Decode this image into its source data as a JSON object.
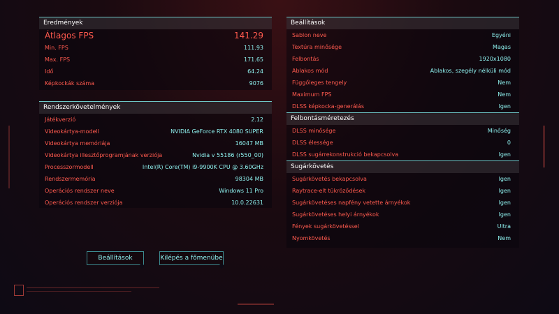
{
  "results": {
    "title": "Eredmények",
    "avg_label": "Átlagos FPS",
    "avg_value": "141.29",
    "rows": [
      {
        "label": "Min. FPS",
        "value": "111.93"
      },
      {
        "label": "Max. FPS",
        "value": "171.65"
      },
      {
        "label": "Idő",
        "value": "64.24"
      },
      {
        "label": "Képkockák száma",
        "value": "9076"
      }
    ]
  },
  "system": {
    "title": "Rendszerkövetelmények",
    "rows": [
      {
        "label": "Játékverzió",
        "value": "2.12"
      },
      {
        "label": "Videokártya-modell",
        "value": "NVIDIA GeForce RTX 4080 SUPER"
      },
      {
        "label": "Videokártya memóriája",
        "value": "16047 MB"
      },
      {
        "label": "Videokártya illesztőprogramjának verziója",
        "value": "Nvidia v 55186 (r550_00)"
      },
      {
        "label": "Processzormodell",
        "value": "Intel(R) Core(TM) i9-9900K CPU @ 3.60GHz"
      },
      {
        "label": "Rendszermemória",
        "value": "98304 MB"
      },
      {
        "label": "Operációs rendszer neve",
        "value": "Windows 11 Pro"
      },
      {
        "label": "Operációs rendszer verziója",
        "value": "10.0.22631"
      }
    ]
  },
  "settings": {
    "title": "Beállítások",
    "rows": [
      {
        "label": "Sablon neve",
        "value": "Egyéni"
      },
      {
        "label": "Textúra minősége",
        "value": "Magas"
      },
      {
        "label": "Felbontás",
        "value": "1920x1080"
      },
      {
        "label": "Ablakos mód",
        "value": "Ablakos, szegély nélküli mód"
      },
      {
        "label": "Függőleges tengely",
        "value": "Nem"
      },
      {
        "label": "Maximum FPS",
        "value": "Nem"
      },
      {
        "label": "DLSS képkocka-generálás",
        "value": "Igen"
      }
    ]
  },
  "scaling": {
    "title": "Felbontásméretezés",
    "rows": [
      {
        "label": "DLSS minősége",
        "value": "Minőség"
      },
      {
        "label": "DLSS élessége",
        "value": "0"
      },
      {
        "label": "DLSS sugárrekonstrukció bekapcsolva",
        "value": "Igen"
      }
    ]
  },
  "raytracing": {
    "title": "Sugárkövetés",
    "rows": [
      {
        "label": "Sugárkövetés bekapcsolva",
        "value": "Igen"
      },
      {
        "label": "Raytrace-elt tükröződések",
        "value": "Igen"
      },
      {
        "label": "Sugárkövetéses napfény vetette árnyékok",
        "value": "Igen"
      },
      {
        "label": "Sugárkövetéses helyi árnyékok",
        "value": "Igen"
      },
      {
        "label": "Fények sugárkövetéssel",
        "value": "Ultra"
      },
      {
        "label": "Nyomkövetés",
        "value": "Nem"
      }
    ]
  },
  "buttons": {
    "settings": "Beállítások",
    "exit": "Kilépés a főmenübe"
  },
  "colors": {
    "label_red": "#ff5a4e",
    "value_cyan": "#8ef0ee",
    "border_cyan": "#6fc8c8"
  }
}
